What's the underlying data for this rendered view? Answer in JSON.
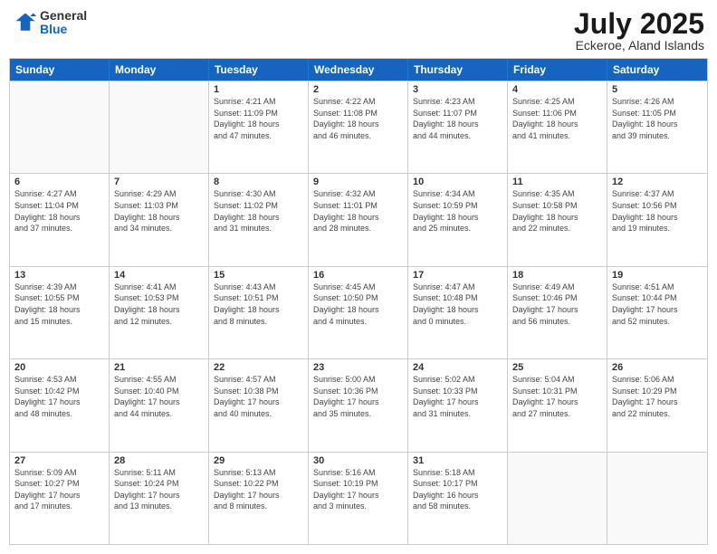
{
  "header": {
    "logo_general": "General",
    "logo_blue": "Blue",
    "month": "July 2025",
    "location": "Eckeroe, Aland Islands"
  },
  "weekdays": [
    "Sunday",
    "Monday",
    "Tuesday",
    "Wednesday",
    "Thursday",
    "Friday",
    "Saturday"
  ],
  "rows": [
    [
      {
        "day": "",
        "info": ""
      },
      {
        "day": "",
        "info": ""
      },
      {
        "day": "1",
        "info": "Sunrise: 4:21 AM\nSunset: 11:09 PM\nDaylight: 18 hours\nand 47 minutes."
      },
      {
        "day": "2",
        "info": "Sunrise: 4:22 AM\nSunset: 11:08 PM\nDaylight: 18 hours\nand 46 minutes."
      },
      {
        "day": "3",
        "info": "Sunrise: 4:23 AM\nSunset: 11:07 PM\nDaylight: 18 hours\nand 44 minutes."
      },
      {
        "day": "4",
        "info": "Sunrise: 4:25 AM\nSunset: 11:06 PM\nDaylight: 18 hours\nand 41 minutes."
      },
      {
        "day": "5",
        "info": "Sunrise: 4:26 AM\nSunset: 11:05 PM\nDaylight: 18 hours\nand 39 minutes."
      }
    ],
    [
      {
        "day": "6",
        "info": "Sunrise: 4:27 AM\nSunset: 11:04 PM\nDaylight: 18 hours\nand 37 minutes."
      },
      {
        "day": "7",
        "info": "Sunrise: 4:29 AM\nSunset: 11:03 PM\nDaylight: 18 hours\nand 34 minutes."
      },
      {
        "day": "8",
        "info": "Sunrise: 4:30 AM\nSunset: 11:02 PM\nDaylight: 18 hours\nand 31 minutes."
      },
      {
        "day": "9",
        "info": "Sunrise: 4:32 AM\nSunset: 11:01 PM\nDaylight: 18 hours\nand 28 minutes."
      },
      {
        "day": "10",
        "info": "Sunrise: 4:34 AM\nSunset: 10:59 PM\nDaylight: 18 hours\nand 25 minutes."
      },
      {
        "day": "11",
        "info": "Sunrise: 4:35 AM\nSunset: 10:58 PM\nDaylight: 18 hours\nand 22 minutes."
      },
      {
        "day": "12",
        "info": "Sunrise: 4:37 AM\nSunset: 10:56 PM\nDaylight: 18 hours\nand 19 minutes."
      }
    ],
    [
      {
        "day": "13",
        "info": "Sunrise: 4:39 AM\nSunset: 10:55 PM\nDaylight: 18 hours\nand 15 minutes."
      },
      {
        "day": "14",
        "info": "Sunrise: 4:41 AM\nSunset: 10:53 PM\nDaylight: 18 hours\nand 12 minutes."
      },
      {
        "day": "15",
        "info": "Sunrise: 4:43 AM\nSunset: 10:51 PM\nDaylight: 18 hours\nand 8 minutes."
      },
      {
        "day": "16",
        "info": "Sunrise: 4:45 AM\nSunset: 10:50 PM\nDaylight: 18 hours\nand 4 minutes."
      },
      {
        "day": "17",
        "info": "Sunrise: 4:47 AM\nSunset: 10:48 PM\nDaylight: 18 hours\nand 0 minutes."
      },
      {
        "day": "18",
        "info": "Sunrise: 4:49 AM\nSunset: 10:46 PM\nDaylight: 17 hours\nand 56 minutes."
      },
      {
        "day": "19",
        "info": "Sunrise: 4:51 AM\nSunset: 10:44 PM\nDaylight: 17 hours\nand 52 minutes."
      }
    ],
    [
      {
        "day": "20",
        "info": "Sunrise: 4:53 AM\nSunset: 10:42 PM\nDaylight: 17 hours\nand 48 minutes."
      },
      {
        "day": "21",
        "info": "Sunrise: 4:55 AM\nSunset: 10:40 PM\nDaylight: 17 hours\nand 44 minutes."
      },
      {
        "day": "22",
        "info": "Sunrise: 4:57 AM\nSunset: 10:38 PM\nDaylight: 17 hours\nand 40 minutes."
      },
      {
        "day": "23",
        "info": "Sunrise: 5:00 AM\nSunset: 10:36 PM\nDaylight: 17 hours\nand 35 minutes."
      },
      {
        "day": "24",
        "info": "Sunrise: 5:02 AM\nSunset: 10:33 PM\nDaylight: 17 hours\nand 31 minutes."
      },
      {
        "day": "25",
        "info": "Sunrise: 5:04 AM\nSunset: 10:31 PM\nDaylight: 17 hours\nand 27 minutes."
      },
      {
        "day": "26",
        "info": "Sunrise: 5:06 AM\nSunset: 10:29 PM\nDaylight: 17 hours\nand 22 minutes."
      }
    ],
    [
      {
        "day": "27",
        "info": "Sunrise: 5:09 AM\nSunset: 10:27 PM\nDaylight: 17 hours\nand 17 minutes."
      },
      {
        "day": "28",
        "info": "Sunrise: 5:11 AM\nSunset: 10:24 PM\nDaylight: 17 hours\nand 13 minutes."
      },
      {
        "day": "29",
        "info": "Sunrise: 5:13 AM\nSunset: 10:22 PM\nDaylight: 17 hours\nand 8 minutes."
      },
      {
        "day": "30",
        "info": "Sunrise: 5:16 AM\nSunset: 10:19 PM\nDaylight: 17 hours\nand 3 minutes."
      },
      {
        "day": "31",
        "info": "Sunrise: 5:18 AM\nSunset: 10:17 PM\nDaylight: 16 hours\nand 58 minutes."
      },
      {
        "day": "",
        "info": ""
      },
      {
        "day": "",
        "info": ""
      }
    ]
  ]
}
